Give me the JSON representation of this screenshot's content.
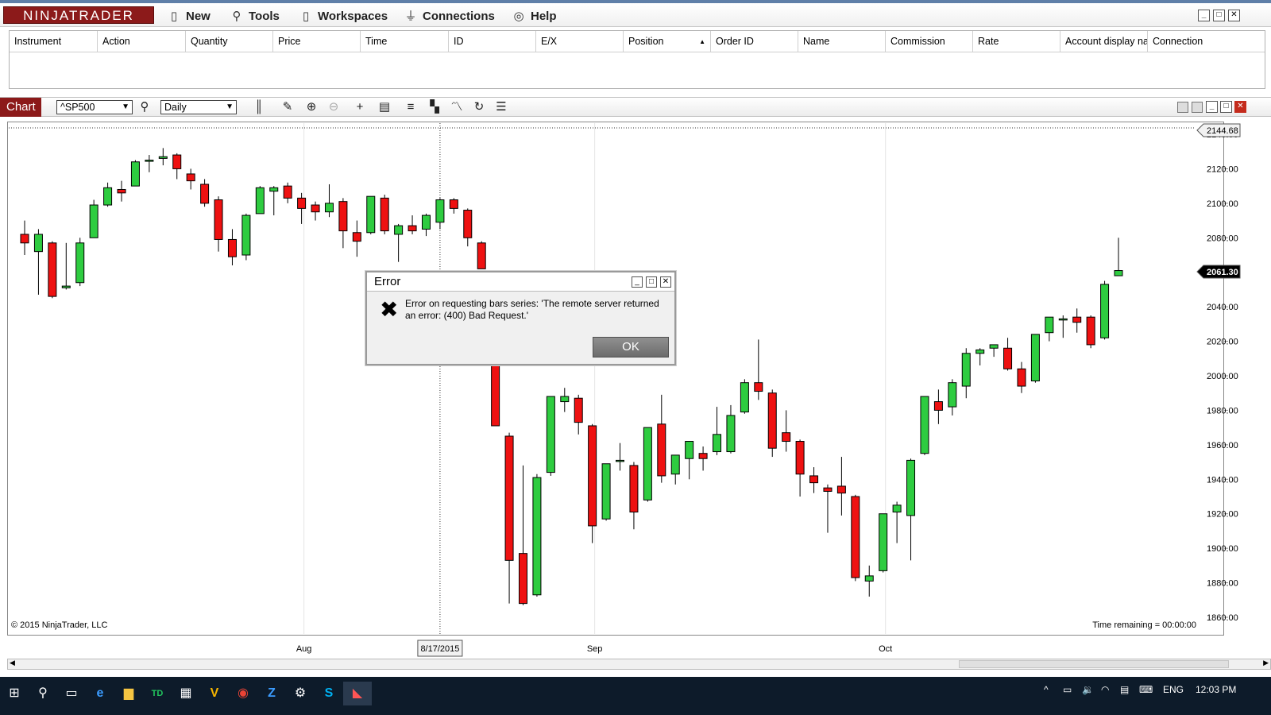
{
  "app": {
    "logo": "NINJATRADER",
    "menu": [
      {
        "label": "New",
        "icon": "new-document-icon",
        "glyph": "🗋"
      },
      {
        "label": "Tools",
        "icon": "tools-icon",
        "glyph": "🔧"
      },
      {
        "label": "Workspaces",
        "icon": "workspaces-icon",
        "glyph": "🗋"
      },
      {
        "label": "Connections",
        "icon": "connections-icon",
        "glyph": "🔌"
      },
      {
        "label": "Help",
        "icon": "help-icon",
        "glyph": "◎"
      }
    ],
    "brand_color": "#8c1a1a"
  },
  "orders": {
    "columns": [
      "Instrument",
      "Action",
      "Quantity",
      "Price",
      "Time",
      "ID",
      "E/X",
      "Position",
      "Order ID",
      "Name",
      "Commission",
      "Rate",
      "Account display na",
      "Connection"
    ],
    "sort_column": "Position",
    "rows": []
  },
  "chart_toolbar": {
    "tab_label": "Chart",
    "instrument": "^SP500",
    "interval": "Daily"
  },
  "chart_meta": {
    "copyright": "© 2015 NinjaTrader, LLC",
    "time_remaining": "Time remaining = 00:00:00",
    "crosshair_price": "2144.68",
    "crosshair_date": "8/17/2015",
    "last_price": "2061.30"
  },
  "chart_data": {
    "type": "candlestick",
    "instrument": "^SP500",
    "ylim": [
      1855,
      2148
    ],
    "y_ticks": [
      2140,
      2120,
      2100,
      2080,
      2060,
      2040,
      2020,
      2000,
      1980,
      1960,
      1940,
      1920,
      1900,
      1880,
      1860
    ],
    "x_ticks": [
      {
        "label": "Aug",
        "index": 20
      },
      {
        "label": "Sep",
        "index": 41
      },
      {
        "label": "Oct",
        "index": 62
      }
    ],
    "crosshair_index": 30,
    "up_color": "#2ecc40",
    "down_color": "#ee1111",
    "bars": [
      {
        "o": 2082,
        "h": 2090,
        "l": 2070,
        "c": 2077
      },
      {
        "o": 2072,
        "h": 2085,
        "l": 2047,
        "c": 2082
      },
      {
        "o": 2077,
        "h": 2078,
        "l": 2045,
        "c": 2046
      },
      {
        "o": 2051,
        "h": 2077,
        "l": 2050,
        "c": 2052
      },
      {
        "o": 2054,
        "h": 2080,
        "l": 2052,
        "c": 2077
      },
      {
        "o": 2080,
        "h": 2102,
        "l": 2080,
        "c": 2099
      },
      {
        "o": 2099,
        "h": 2112,
        "l": 2098,
        "c": 2109
      },
      {
        "o": 2108,
        "h": 2113,
        "l": 2101,
        "c": 2106
      },
      {
        "o": 2110,
        "h": 2125,
        "l": 2110,
        "c": 2124
      },
      {
        "o": 2125,
        "h": 2128,
        "l": 2118,
        "c": 2125
      },
      {
        "o": 2126,
        "h": 2132,
        "l": 2122,
        "c": 2127
      },
      {
        "o": 2128,
        "h": 2129,
        "l": 2114,
        "c": 2120
      },
      {
        "o": 2117,
        "h": 2120,
        "l": 2108,
        "c": 2113
      },
      {
        "o": 2111,
        "h": 2114,
        "l": 2098,
        "c": 2100
      },
      {
        "o": 2102,
        "h": 2104,
        "l": 2072,
        "c": 2079
      },
      {
        "o": 2079,
        "h": 2085,
        "l": 2064,
        "c": 2069
      },
      {
        "o": 2070,
        "h": 2094,
        "l": 2067,
        "c": 2093
      },
      {
        "o": 2094,
        "h": 2110,
        "l": 2094,
        "c": 2109
      },
      {
        "o": 2107,
        "h": 2110,
        "l": 2093,
        "c": 2109
      },
      {
        "o": 2110,
        "h": 2112,
        "l": 2100,
        "c": 2103
      },
      {
        "o": 2103,
        "h": 2106,
        "l": 2088,
        "c": 2097
      },
      {
        "o": 2099,
        "h": 2101,
        "l": 2090,
        "c": 2095
      },
      {
        "o": 2095,
        "h": 2111,
        "l": 2092,
        "c": 2100
      },
      {
        "o": 2101,
        "h": 2103,
        "l": 2074,
        "c": 2084
      },
      {
        "o": 2083,
        "h": 2090,
        "l": 2069,
        "c": 2078
      },
      {
        "o": 2083,
        "h": 2104,
        "l": 2082,
        "c": 2104
      },
      {
        "o": 2103,
        "h": 2105,
        "l": 2082,
        "c": 2084
      },
      {
        "o": 2082,
        "h": 2088,
        "l": 2066,
        "c": 2087
      },
      {
        "o": 2087,
        "h": 2093,
        "l": 2082,
        "c": 2084
      },
      {
        "o": 2085,
        "h": 2094,
        "l": 2081,
        "c": 2093
      },
      {
        "o": 2089,
        "h": 2103,
        "l": 2085,
        "c": 2102
      },
      {
        "o": 2102,
        "h": 2103,
        "l": 2094,
        "c": 2097
      },
      {
        "o": 2096,
        "h": 2097,
        "l": 2075,
        "c": 2080
      },
      {
        "o": 2077,
        "h": 2078,
        "l": 2062,
        "c": 2062
      },
      {
        "o": 2035,
        "h": 2040,
        "l": 1975,
        "c": 1971
      },
      {
        "o": 1965,
        "h": 1967,
        "l": 1868,
        "c": 1893
      },
      {
        "o": 1897,
        "h": 1948,
        "l": 1867,
        "c": 1868
      },
      {
        "o": 1873,
        "h": 1943,
        "l": 1872,
        "c": 1941
      },
      {
        "o": 1944,
        "h": 1988,
        "l": 1942,
        "c": 1988
      },
      {
        "o": 1985,
        "h": 1993,
        "l": 1979,
        "c": 1988
      },
      {
        "o": 1987,
        "h": 1989,
        "l": 1966,
        "c": 1973
      },
      {
        "o": 1971,
        "h": 1972,
        "l": 1903,
        "c": 1913
      },
      {
        "o": 1917,
        "h": 1949,
        "l": 1916,
        "c": 1949
      },
      {
        "o": 1951,
        "h": 1961,
        "l": 1945,
        "c": 1951
      },
      {
        "o": 1948,
        "h": 1950,
        "l": 1911,
        "c": 1921
      },
      {
        "o": 1928,
        "h": 1970,
        "l": 1927,
        "c": 1970
      },
      {
        "o": 1972,
        "h": 1989,
        "l": 1938,
        "c": 1942
      },
      {
        "o": 1943,
        "h": 1954,
        "l": 1937,
        "c": 1954
      },
      {
        "o": 1952,
        "h": 1962,
        "l": 1940,
        "c": 1962
      },
      {
        "o": 1955,
        "h": 1959,
        "l": 1945,
        "c": 1952
      },
      {
        "o": 1956,
        "h": 1982,
        "l": 1954,
        "c": 1966
      },
      {
        "o": 1956,
        "h": 1983,
        "l": 1955,
        "c": 1977
      },
      {
        "o": 1979,
        "h": 1998,
        "l": 1978,
        "c": 1996
      },
      {
        "o": 1996,
        "h": 2021,
        "l": 1986,
        "c": 1991
      },
      {
        "o": 1990,
        "h": 1992,
        "l": 1953,
        "c": 1958
      },
      {
        "o": 1967,
        "h": 1980,
        "l": 1956,
        "c": 1962
      },
      {
        "o": 1962,
        "h": 1963,
        "l": 1930,
        "c": 1943
      },
      {
        "o": 1942,
        "h": 1947,
        "l": 1932,
        "c": 1938
      },
      {
        "o": 1935,
        "h": 1937,
        "l": 1909,
        "c": 1933
      },
      {
        "o": 1936,
        "h": 1953,
        "l": 1919,
        "c": 1932
      },
      {
        "o": 1930,
        "h": 1931,
        "l": 1881,
        "c": 1883
      },
      {
        "o": 1881,
        "h": 1890,
        "l": 1872,
        "c": 1884
      },
      {
        "o": 1887,
        "h": 1920,
        "l": 1886,
        "c": 1920
      },
      {
        "o": 1921,
        "h": 1927,
        "l": 1903,
        "c": 1925
      },
      {
        "o": 1919,
        "h": 1952,
        "l": 1893,
        "c": 1951
      },
      {
        "o": 1955,
        "h": 1988,
        "l": 1954,
        "c": 1988
      },
      {
        "o": 1985,
        "h": 1992,
        "l": 1972,
        "c": 1980
      },
      {
        "o": 1982,
        "h": 1998,
        "l": 1977,
        "c": 1996
      },
      {
        "o": 1994,
        "h": 2016,
        "l": 1987,
        "c": 2013
      },
      {
        "o": 2013,
        "h": 2016,
        "l": 2006,
        "c": 2015
      },
      {
        "o": 2016,
        "h": 2018,
        "l": 2011,
        "c": 2018
      },
      {
        "o": 2016,
        "h": 2022,
        "l": 2003,
        "c": 2004
      },
      {
        "o": 2004,
        "h": 2008,
        "l": 1990,
        "c": 1994
      },
      {
        "o": 1997,
        "h": 2024,
        "l": 1996,
        "c": 2024
      },
      {
        "o": 2025,
        "h": 2034,
        "l": 2020,
        "c": 2034
      },
      {
        "o": 2033,
        "h": 2035,
        "l": 2022,
        "c": 2033
      },
      {
        "o": 2034,
        "h": 2039,
        "l": 2025,
        "c": 2031
      },
      {
        "o": 2034,
        "h": 2035,
        "l": 2016,
        "c": 2018
      },
      {
        "o": 2022,
        "h": 2055,
        "l": 2021,
        "c": 2053
      },
      {
        "o": 2058,
        "h": 2080,
        "l": 2058,
        "c": 2061
      }
    ]
  },
  "dialog": {
    "title": "Error",
    "message": "Error on requesting bars series: 'The remote server returned an error: (400) Bad Request.'",
    "ok_label": "OK"
  },
  "taskbar": {
    "language": "ENG",
    "clock": "12:03 PM"
  }
}
